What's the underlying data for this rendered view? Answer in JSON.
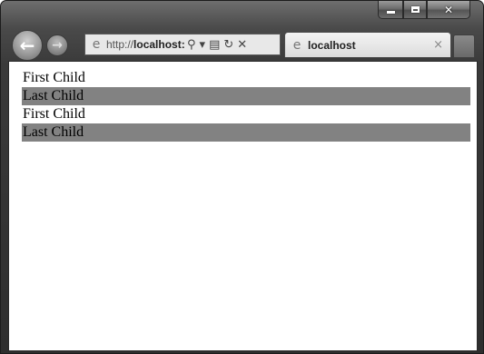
{
  "window": {
    "caption_buttons": {
      "minimize_icon": "minimize-icon",
      "maximize_icon": "maximize-icon",
      "close_icon": "close-icon",
      "close_glyph": "✕"
    }
  },
  "nav": {
    "back_glyph": "←",
    "forward_glyph": "→"
  },
  "address_bar": {
    "url_prefix": "http://",
    "url_host": "localhost:",
    "search_glyph": "⚲",
    "dropdown_glyph": "▾",
    "compat_glyph": "▤",
    "refresh_glyph": "↻",
    "stop_glyph": "✕"
  },
  "tab": {
    "title": "localhost",
    "close_glyph": "×",
    "favicon": "ie-page-icon"
  },
  "content": {
    "lines": [
      {
        "text": "First Child",
        "highlighted": false
      },
      {
        "text": "Last Child",
        "highlighted": true
      },
      {
        "text": "First Child",
        "highlighted": false
      },
      {
        "text": "Last Child",
        "highlighted": true
      }
    ],
    "highlight_color": "#828282"
  }
}
